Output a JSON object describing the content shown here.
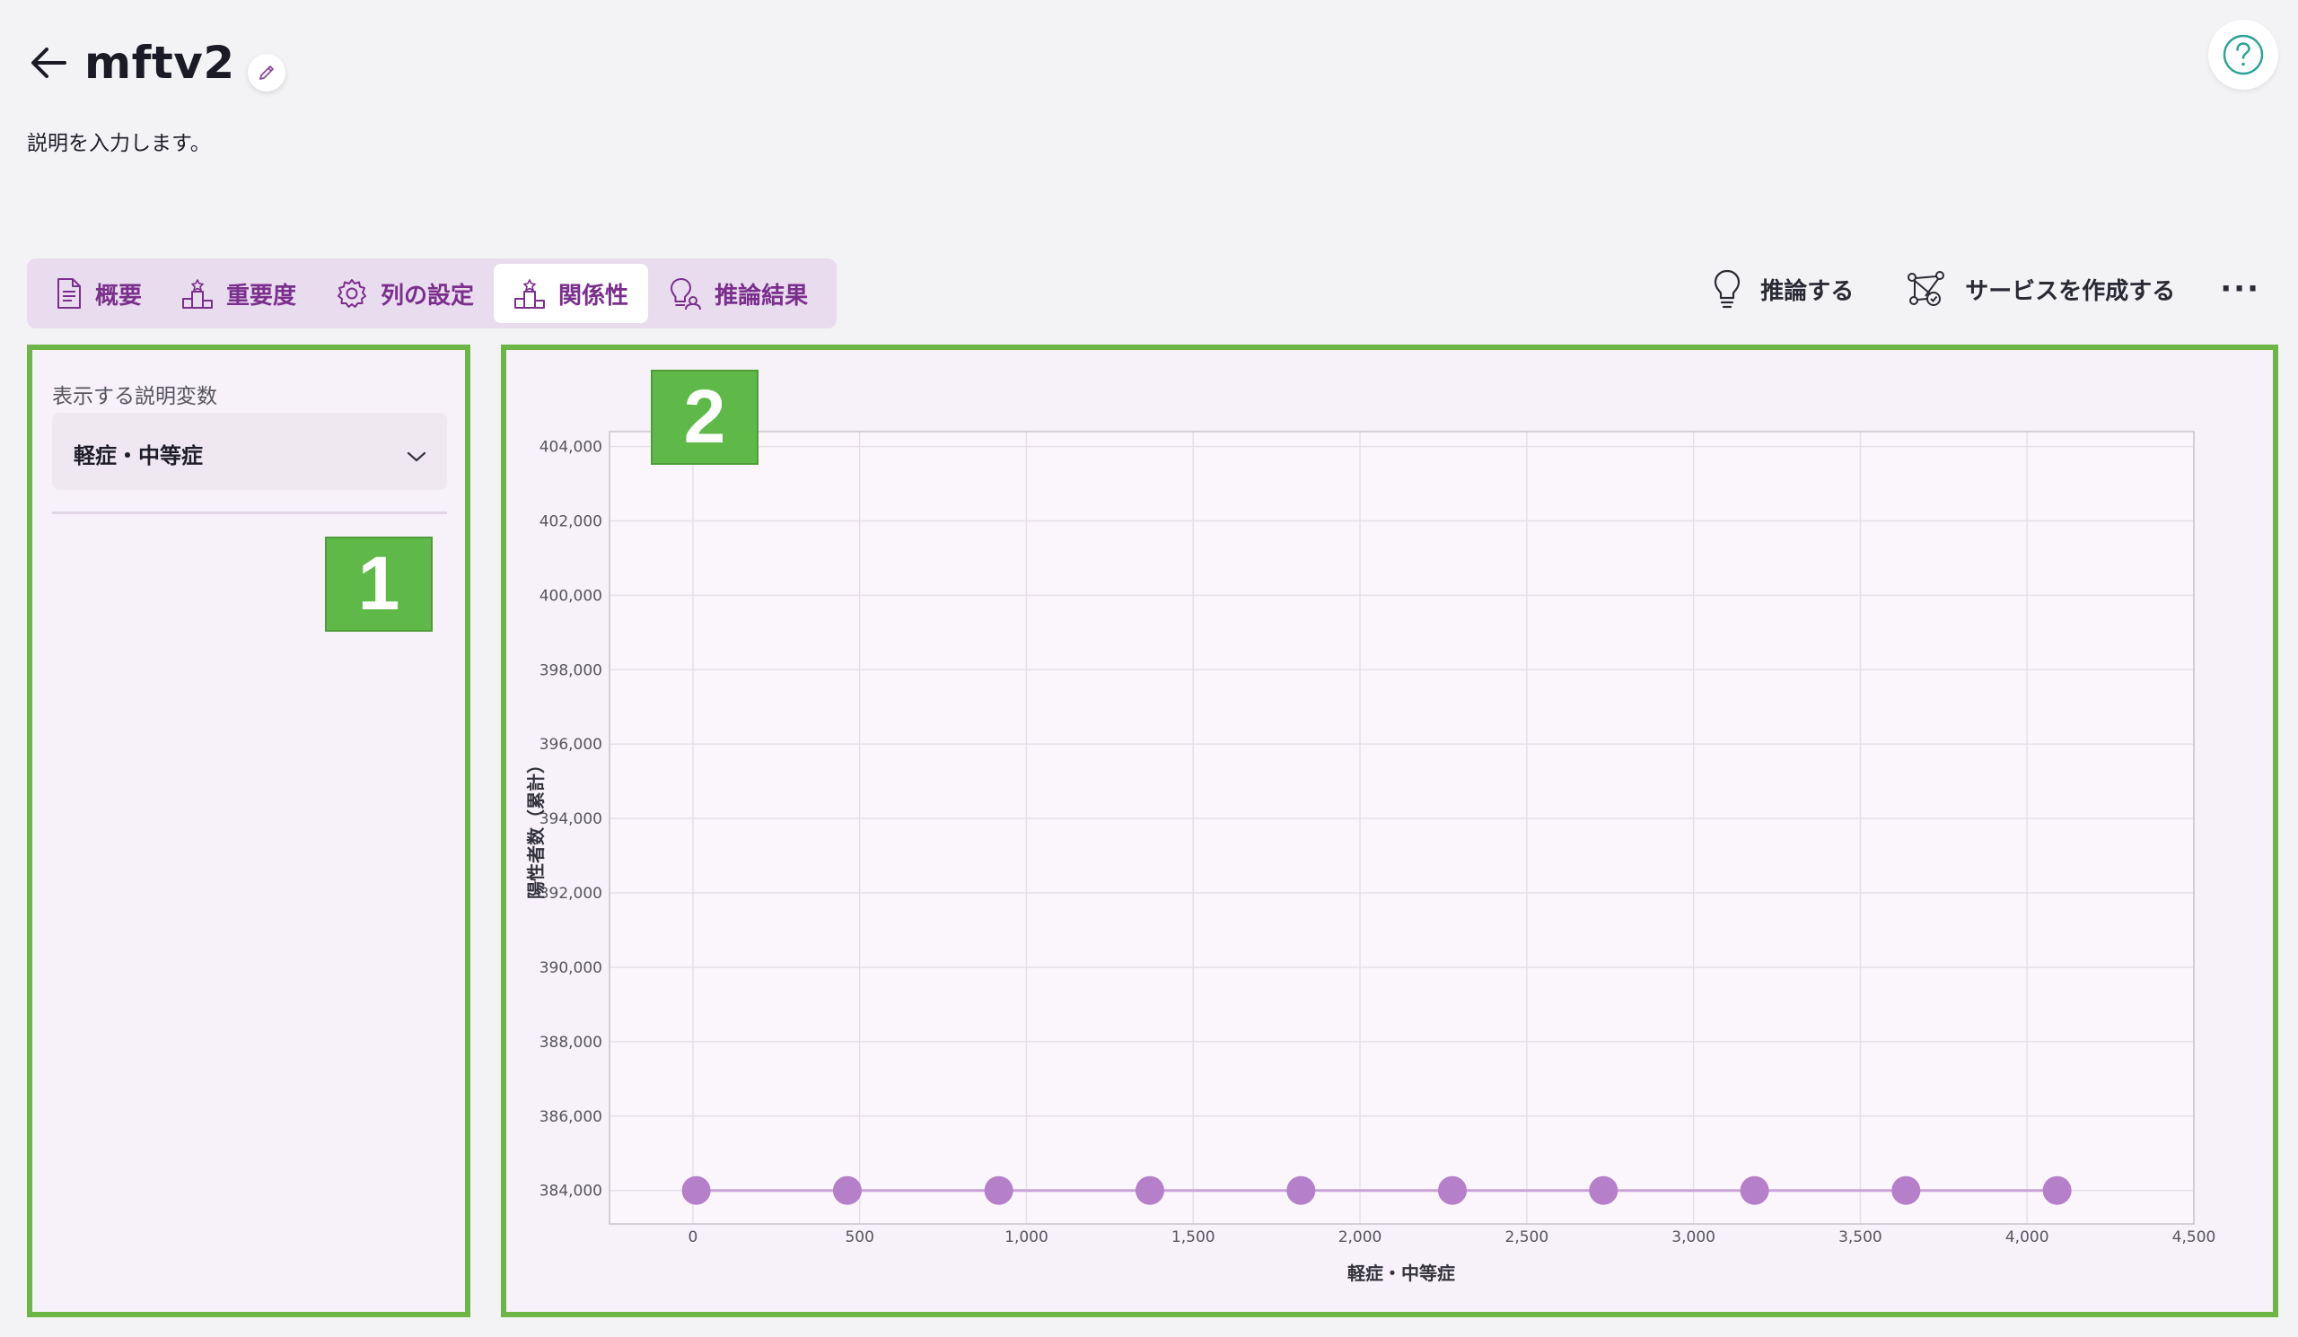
{
  "header": {
    "title": "mftv2",
    "description": "説明を入力します。"
  },
  "tabs": [
    {
      "label": "概要",
      "icon": "document-icon",
      "active": false
    },
    {
      "label": "重要度",
      "icon": "podium-icon",
      "active": false
    },
    {
      "label": "列の設定",
      "icon": "gear-icon",
      "active": false
    },
    {
      "label": "関係性",
      "icon": "podium-icon",
      "active": true
    },
    {
      "label": "推論結果",
      "icon": "lightbulb-person-icon",
      "active": false
    }
  ],
  "actions": {
    "infer_label": "推論する",
    "create_service_label": "サービスを作成する",
    "more_label": "···"
  },
  "left_panel": {
    "label": "表示する説明変数",
    "selected_variable": "軽症・中等症",
    "marker": "1"
  },
  "right_panel": {
    "marker": "2"
  },
  "colors": {
    "accent": "#7a2f8c",
    "tab_bg": "#e9dcee",
    "panel_bg": "#f7f1f9",
    "highlight_border": "#6db544",
    "marker_bg": "#5fb948",
    "point": "#b57fc9",
    "line": "#c9a2d8"
  },
  "chart_data": {
    "type": "line",
    "xlabel": "軽症・中等症",
    "ylabel": "陽性者数（累計）",
    "xlim": [
      -250,
      4500
    ],
    "ylim": [
      383100,
      404400
    ],
    "x_ticks": [
      0,
      500,
      1000,
      1500,
      2000,
      2500,
      3000,
      3500,
      4000,
      4500
    ],
    "x_tick_labels": [
      "0",
      "500",
      "1,000",
      "1,500",
      "2,000",
      "2,500",
      "3,000",
      "3,500",
      "4,000",
      "4,500"
    ],
    "y_ticks": [
      384000,
      386000,
      388000,
      390000,
      392000,
      394000,
      396000,
      398000,
      400000,
      402000,
      404000
    ],
    "y_tick_labels": [
      "384,000",
      "386,000",
      "388,000",
      "390,000",
      "392,000",
      "394,000",
      "396,000",
      "398,000",
      "400,000",
      "402,000",
      "404,000"
    ],
    "grid": true,
    "series": [
      {
        "x": [
          10,
          463,
          917,
          1370,
          1823,
          2277,
          2730,
          3183,
          3637,
          4090
        ],
        "y": [
          384000,
          384000,
          384000,
          384000,
          384000,
          384000,
          384000,
          384000,
          384000,
          384000
        ]
      }
    ]
  }
}
